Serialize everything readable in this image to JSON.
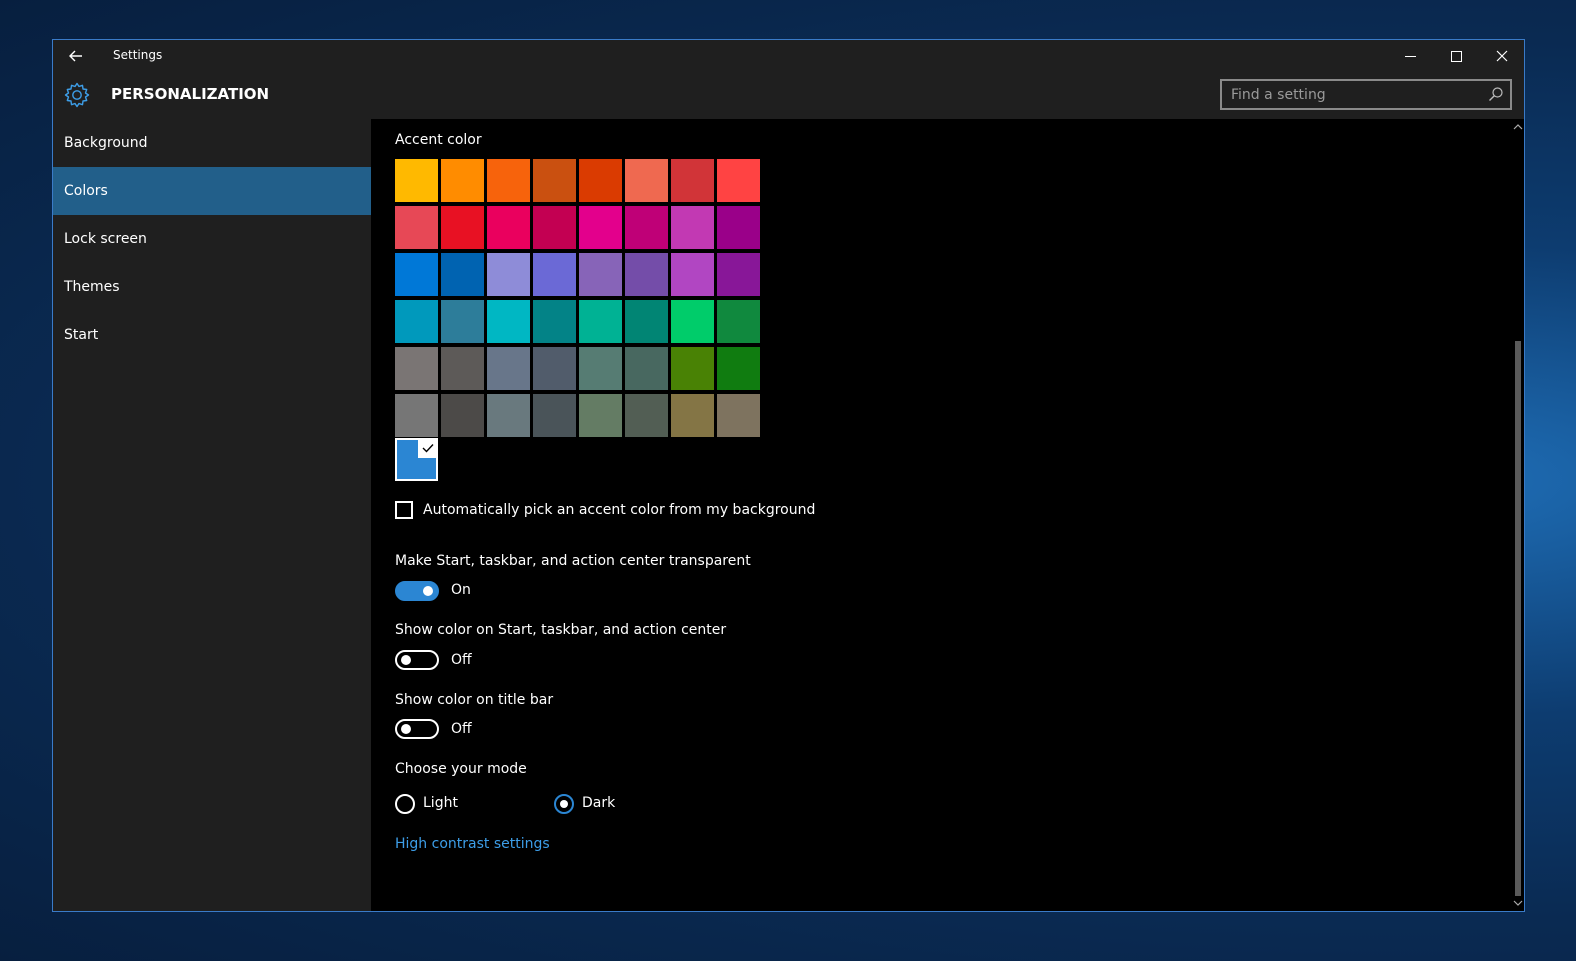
{
  "window": {
    "app_title": "Settings",
    "section_title": "PERSONALIZATION",
    "search_placeholder": "Find a setting"
  },
  "sidebar": {
    "items": [
      {
        "label": "Background"
      },
      {
        "label": "Colors"
      },
      {
        "label": "Lock screen"
      },
      {
        "label": "Themes"
      },
      {
        "label": "Start"
      }
    ],
    "active": "Colors"
  },
  "colors_page": {
    "accent_heading": "Accent color",
    "palette": [
      [
        "#ffb900",
        "#ff8c00",
        "#f7630c",
        "#ca5010",
        "#da3b01",
        "#ef6950",
        "#d13438",
        "#ff4343"
      ],
      [
        "#e74856",
        "#e81123",
        "#ea005e",
        "#c30052",
        "#e3008c",
        "#bf0077",
        "#c239b3",
        "#9a0089"
      ],
      [
        "#0078d7",
        "#0063b1",
        "#8e8cd8",
        "#6b69d6",
        "#8764b8",
        "#744da9",
        "#b146c2",
        "#881798"
      ],
      [
        "#0099bc",
        "#2d7d9a",
        "#00b7c3",
        "#038387",
        "#00b294",
        "#018574",
        "#00cc6a",
        "#10893e"
      ],
      [
        "#7a7574",
        "#5d5a58",
        "#68768a",
        "#515c6b",
        "#567c73",
        "#486860",
        "#498205",
        "#107c10"
      ],
      [
        "#767676",
        "#4c4a48",
        "#69797e",
        "#4a5459",
        "#647c64",
        "#525e54",
        "#847545",
        "#7e735f"
      ]
    ],
    "selected_color": "#2b86d3",
    "auto_pick_label": "Automatically pick an accent color from my background",
    "transparent": {
      "label": "Make Start, taskbar, and action center transparent",
      "state": "On"
    },
    "show_color_start": {
      "label": "Show color on Start, taskbar, and action center",
      "state": "Off"
    },
    "show_color_titlebar": {
      "label": "Show color on title bar",
      "state": "Off"
    },
    "mode": {
      "label": "Choose your mode",
      "options": [
        "Light",
        "Dark"
      ],
      "selected": "Dark"
    },
    "high_contrast_link": "High contrast settings"
  }
}
